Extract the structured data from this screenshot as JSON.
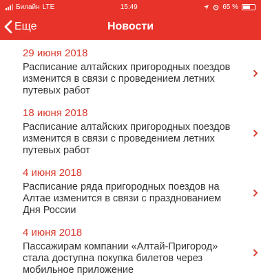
{
  "status_bar": {
    "carrier": "Билайн",
    "network": "LTE",
    "time": "15:49",
    "battery_percent": "65 %",
    "battery_level": 0.65
  },
  "nav": {
    "back_label": "Еще",
    "title": "Новости"
  },
  "news": [
    {
      "date": "29 июня 2018",
      "text": "Расписание алтайских пригородных поездов изменится в связи с проведением летних путевых работ"
    },
    {
      "date": "18 июня 2018",
      "text": "Расписание алтайских пригородных поездов изменится в связи с проведением летних путевых работ"
    },
    {
      "date": "4 июня 2018",
      "text": "Расписание ряда пригородных поездов на Алтае изменится в связи с празднованием Дня России"
    },
    {
      "date": "4 июня 2018",
      "text": "Пассажирам компании «Алтай-Пригород» стала доступна покупка билетов через мобильное приложение"
    }
  ],
  "colors": {
    "accent": "#e8332a",
    "date": "#d93a2d"
  }
}
